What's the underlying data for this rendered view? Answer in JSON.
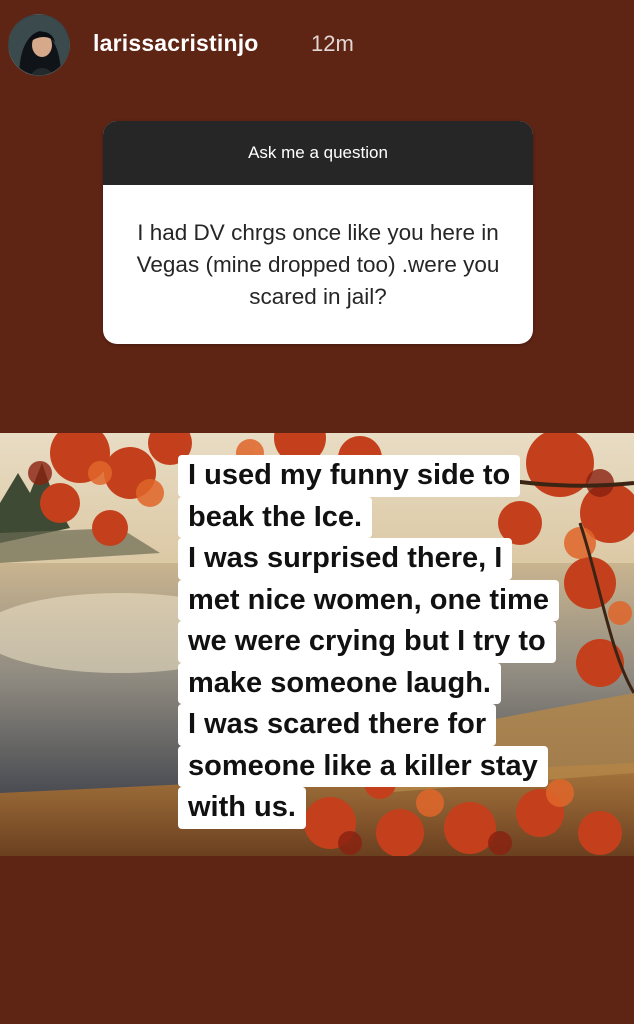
{
  "story": {
    "username": "larissacristinjo",
    "timestamp": "12m"
  },
  "question_sticker": {
    "header": "Ask me a question",
    "question": "I had DV chrgs once like you here in Vegas (mine dropped too) .were you scared in jail?"
  },
  "answer": {
    "lines": [
      "I used my funny side to",
      "beak the Ice.",
      "I was surprised there, I",
      "met nice women, one time",
      "we were crying but I try to",
      "make someone laugh.",
      "I was scared there for",
      "someone like a killer stay",
      "with us."
    ]
  },
  "colors": {
    "background": "#5e2414",
    "card_header": "#262626",
    "card_body": "#ffffff"
  },
  "icons": {
    "avatar": "profile-photo",
    "photo": "autumn-lake-photo"
  }
}
